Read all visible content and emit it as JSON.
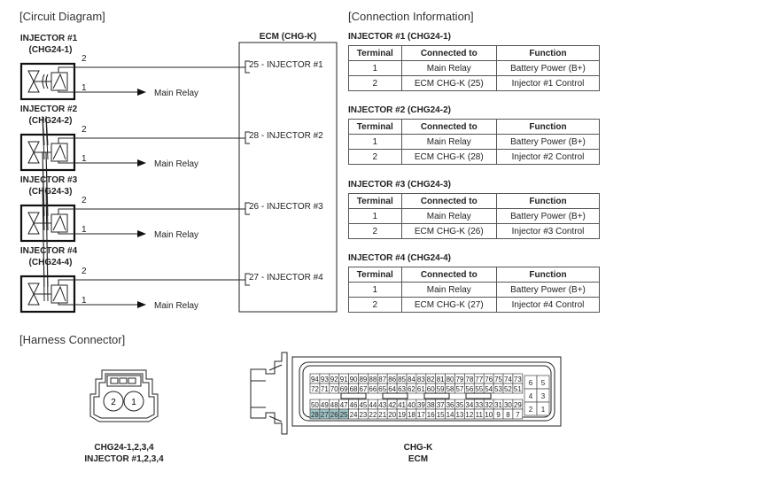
{
  "sections": {
    "circuit": "[Circuit Diagram]",
    "connection": "[Connection Information]",
    "harness": "[Harness Connector]"
  },
  "ecm": {
    "title": "ECM (CHG-K)"
  },
  "injectors": [
    {
      "name": "INJECTOR #1",
      "connector": "(CHG24-1)",
      "pin_top": "2",
      "pin_bottom": "1",
      "relay": "Main Relay",
      "ecm_pin": "25 - INJECTOR #1"
    },
    {
      "name": "INJECTOR #2",
      "connector": "(CHG24-2)",
      "pin_top": "2",
      "pin_bottom": "1",
      "relay": "Main Relay",
      "ecm_pin": "28 - INJECTOR #2"
    },
    {
      "name": "INJECTOR #3",
      "connector": "(CHG24-3)",
      "pin_top": "2",
      "pin_bottom": "1",
      "relay": "Main Relay",
      "ecm_pin": "26 - INJECTOR #3"
    },
    {
      "name": "INJECTOR #4",
      "connector": "(CHG24-4)",
      "pin_top": "2",
      "pin_bottom": "1",
      "relay": "Main Relay",
      "ecm_pin": "27 - INJECTOR #4"
    }
  ],
  "tables": [
    {
      "title": "INJECTOR #1 (CHG24-1)",
      "headers": [
        "Terminal",
        "Connected to",
        "Function"
      ],
      "rows": [
        [
          "1",
          "Main Relay",
          "Battery Power (B+)"
        ],
        [
          "2",
          "ECM CHG-K (25)",
          "Injector #1 Control"
        ]
      ]
    },
    {
      "title": "INJECTOR #2 (CHG24-2)",
      "headers": [
        "Terminal",
        "Connected to",
        "Function"
      ],
      "rows": [
        [
          "1",
          "Main Relay",
          "Battery Power (B+)"
        ],
        [
          "2",
          "ECM CHG-K (28)",
          "Injector #2 Control"
        ]
      ]
    },
    {
      "title": "INJECTOR #3 (CHG24-3)",
      "headers": [
        "Terminal",
        "Connected to",
        "Function"
      ],
      "rows": [
        [
          "1",
          "Main Relay",
          "Battery Power (B+)"
        ],
        [
          "2",
          "ECM CHG-K (26)",
          "Injector #3 Control"
        ]
      ]
    },
    {
      "title": "INJECTOR #4 (CHG24-4)",
      "headers": [
        "Terminal",
        "Connected to",
        "Function"
      ],
      "rows": [
        [
          "1",
          "Main Relay",
          "Battery Power (B+)"
        ],
        [
          "2",
          "ECM CHG-K (27)",
          "Injector #4 Control"
        ]
      ]
    }
  ],
  "harness": {
    "injector_connector": {
      "pins": [
        "2",
        "1"
      ],
      "label1": "CHG24-1,2,3,4",
      "label2": "INJECTOR #1,2,3,4"
    },
    "ecm_connector": {
      "label1": "CHG-K",
      "label2": "ECM",
      "highlight_color": "#9fc3c6",
      "highlighted": [
        "28",
        "27",
        "26",
        "25"
      ],
      "rows": [
        [
          "94",
          "93",
          "92",
          "91",
          "90",
          "89",
          "88",
          "87",
          "86",
          "85",
          "84",
          "83",
          "82",
          "81",
          "80",
          "79",
          "78",
          "77",
          "76",
          "75",
          "74",
          "73"
        ],
        [
          "72",
          "71",
          "70",
          "69",
          "68",
          "67",
          "66",
          "65",
          "64",
          "63",
          "62",
          "61",
          "60",
          "59",
          "58",
          "57",
          "56",
          "55",
          "54",
          "53",
          "52",
          "51"
        ],
        [
          "50",
          "49",
          "48",
          "47",
          "46",
          "45",
          "44",
          "43",
          "42",
          "41",
          "40",
          "39",
          "38",
          "37",
          "36",
          "35",
          "34",
          "33",
          "32",
          "31",
          "30",
          "29"
        ],
        [
          "28",
          "27",
          "26",
          "25",
          "24",
          "23",
          "22",
          "21",
          "20",
          "19",
          "18",
          "17",
          "16",
          "15",
          "14",
          "13",
          "12",
          "11",
          "10",
          "9",
          "8",
          "7"
        ]
      ],
      "side_block": [
        [
          "6",
          "5"
        ],
        [
          "4",
          "3"
        ],
        [
          "2",
          "1"
        ]
      ]
    }
  }
}
